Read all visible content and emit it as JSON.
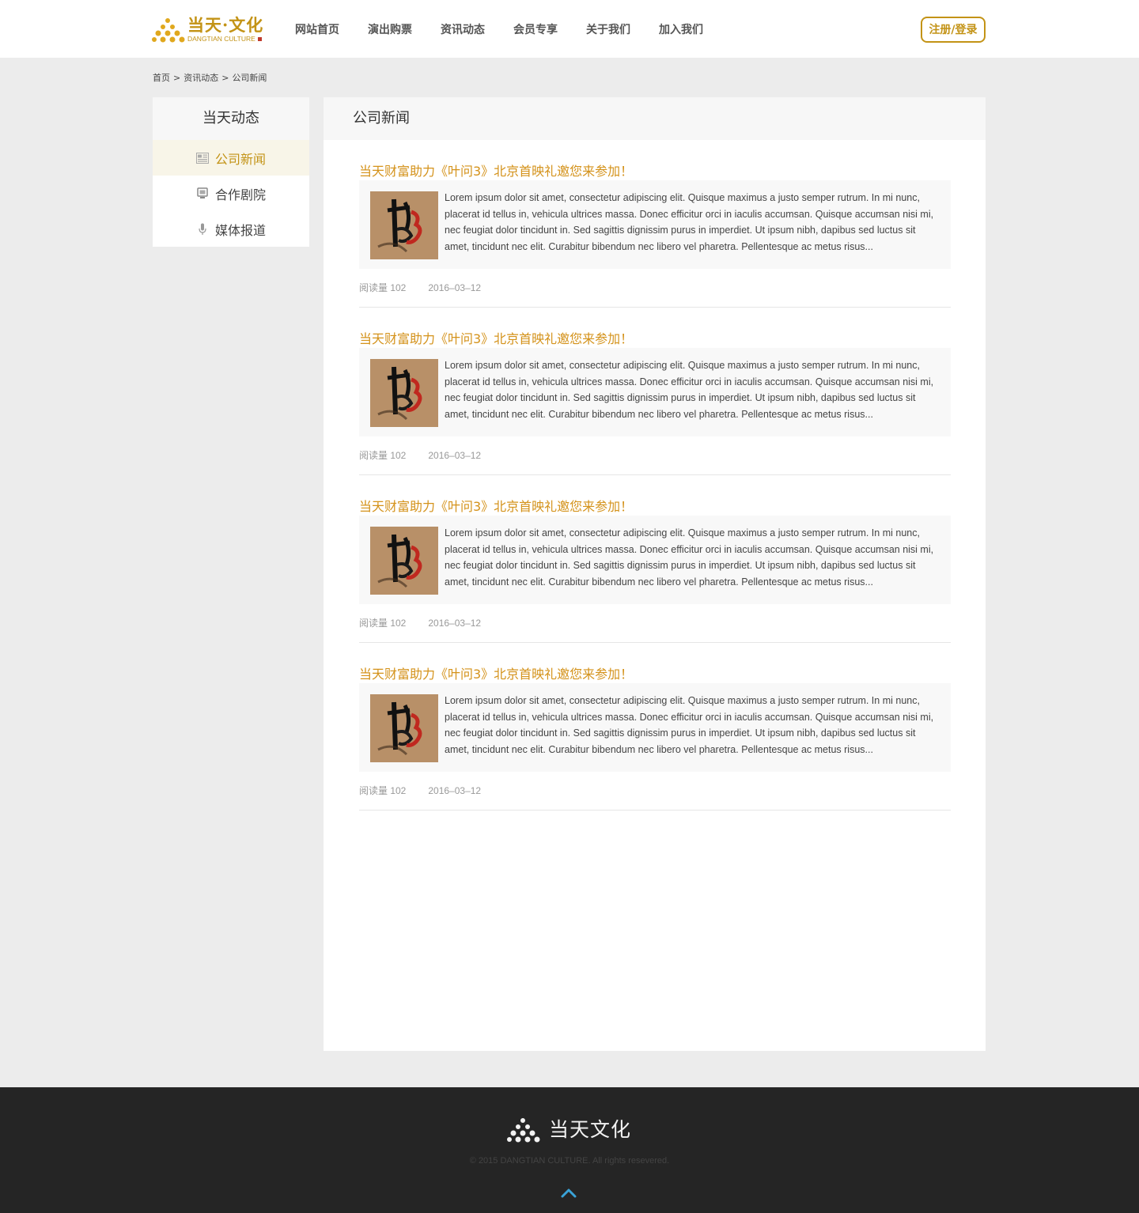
{
  "brand": {
    "name_cn": "当天·文化",
    "name_en": "DANGTIAN CULTURE",
    "color": "#c39316"
  },
  "nav": {
    "items": [
      "网站首页",
      "演出购票",
      "资讯动态",
      "会员专享",
      "关于我们",
      "加入我们"
    ],
    "login_label": "注册/登录"
  },
  "breadcrumb": {
    "home": "首页",
    "section": "资讯动态",
    "current": "公司新闻",
    "separator": ">"
  },
  "sidebar": {
    "title": "当天动态",
    "items": [
      {
        "label": "公司新闻",
        "icon": "newspaper-icon",
        "active": true
      },
      {
        "label": "合作剧院",
        "icon": "theater-icon",
        "active": false
      },
      {
        "label": "媒体报道",
        "icon": "microphone-icon",
        "active": false
      }
    ]
  },
  "main": {
    "title": "公司新闻",
    "articles": [
      {
        "title": "当天财富助力《叶问3》北京首映礼邀您来参加！",
        "excerpt": "Lorem ipsum dolor sit amet, consectetur adipiscing elit. Quisque maximus a justo semper rutrum. In mi nunc, placerat id tellus in, vehicula ultrices massa. Donec efficitur orci in iaculis accumsan. Quisque accumsan nisi mi, nec feugiat dolor tincidunt in. Sed sagittis dignissim purus in imperdiet. Ut ipsum nibh, dapibus sed luctus sit amet, tincidunt nec elit. Curabitur bibendum nec libero vel pharetra. Pellentesque ac metus risus...",
        "views": "阅读量 102",
        "date": "2016–03–12"
      },
      {
        "title": "当天财富助力《叶问3》北京首映礼邀您来参加！",
        "excerpt": "Lorem ipsum dolor sit amet, consectetur adipiscing elit. Quisque maximus a justo semper rutrum. In mi nunc, placerat id tellus in, vehicula ultrices massa. Donec efficitur orci in iaculis accumsan. Quisque accumsan nisi mi, nec feugiat dolor tincidunt in. Sed sagittis dignissim purus in imperdiet. Ut ipsum nibh, dapibus sed luctus sit amet, tincidunt nec elit. Curabitur bibendum nec libero vel pharetra. Pellentesque ac metus risus...",
        "views": "阅读量 102",
        "date": "2016–03–12"
      },
      {
        "title": "当天财富助力《叶问3》北京首映礼邀您来参加！",
        "excerpt": "Lorem ipsum dolor sit amet, consectetur adipiscing elit. Quisque maximus a justo semper rutrum. In mi nunc, placerat id tellus in, vehicula ultrices massa. Donec efficitur orci in iaculis accumsan. Quisque accumsan nisi mi, nec feugiat dolor tincidunt in. Sed sagittis dignissim purus in imperdiet. Ut ipsum nibh, dapibus sed luctus sit amet, tincidunt nec elit. Curabitur bibendum nec libero vel pharetra. Pellentesque ac metus risus...",
        "views": "阅读量 102",
        "date": "2016–03–12"
      },
      {
        "title": "当天财富助力《叶问3》北京首映礼邀您来参加！",
        "excerpt": "Lorem ipsum dolor sit amet, consectetur adipiscing elit. Quisque maximus a justo semper rutrum. In mi nunc, placerat id tellus in, vehicula ultrices massa. Donec efficitur orci in iaculis accumsan. Quisque accumsan nisi mi, nec feugiat dolor tincidunt in. Sed sagittis dignissim purus in imperdiet. Ut ipsum nibh, dapibus sed luctus sit amet, tincidunt nec elit. Curabitur bibendum nec libero vel pharetra. Pellentesque ac metus risus...",
        "views": "阅读量 102",
        "date": "2016–03–12"
      }
    ]
  },
  "footer": {
    "logo_text": "当天文化",
    "copyright": "© 2015 DANGTIAN CULTURE. All rights resevered.",
    "back_to_top_icon": "chevron-up-icon",
    "accent": "#3aa3d8"
  }
}
